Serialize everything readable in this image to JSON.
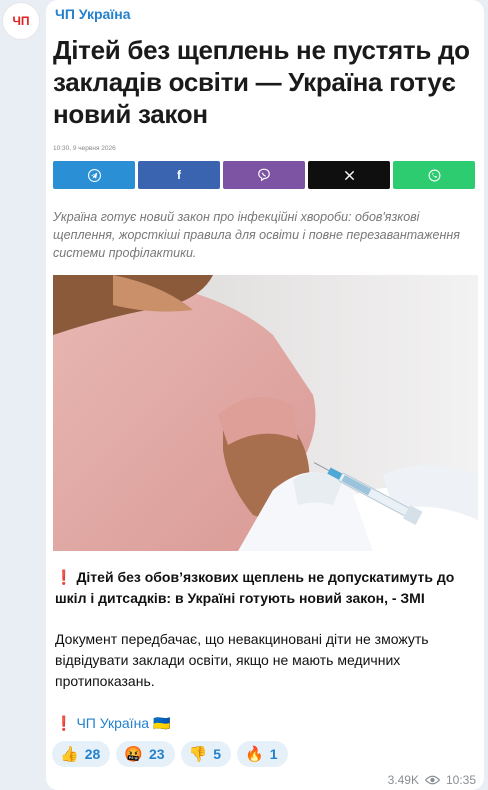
{
  "channel": {
    "avatar_text": "ЧП",
    "name": "ЧП Україна"
  },
  "preview": {
    "headline": "Дітей без щеплень не пустять до закладів освіти — Україна готує новий закон",
    "date": "10:30, 9 червня 2026",
    "share_buttons": [
      {
        "icon": "telegram-icon",
        "color": "#2b8fd6"
      },
      {
        "icon": "facebook-icon",
        "color": "#3b64b0"
      },
      {
        "icon": "viber-icon",
        "color": "#7d53a4"
      },
      {
        "icon": "x-icon",
        "color": "#0f0f0f"
      },
      {
        "icon": "whatsapp-icon",
        "color": "#2ecc71"
      }
    ],
    "lead": "Україна готує новий закон про інфекційні хвороби: обов'язкові щеплення, жорсткіші правила для освіти і повне перезавантаження системи профілактики."
  },
  "message": {
    "line1": "Дітей без обов’язкових щеплень не допускатимуть до шкіл і дитсадків: в Україні готують новий закон, - ЗМІ",
    "line2": "Документ передбачає, що невакциновані діти не зможуть відвідувати заклади освіти, якщо не мають медичних протипоказань.",
    "signature": "ЧП Україна",
    "signature_flag": "🇺🇦",
    "exclamation": "❗"
  },
  "reactions": [
    {
      "emoji": "👍",
      "count": "28"
    },
    {
      "emoji": "🤬",
      "count": "23"
    },
    {
      "emoji": "👎",
      "count": "5"
    },
    {
      "emoji": "🔥",
      "count": "1"
    }
  ],
  "meta": {
    "views": "3.49K",
    "time": "10:35"
  }
}
